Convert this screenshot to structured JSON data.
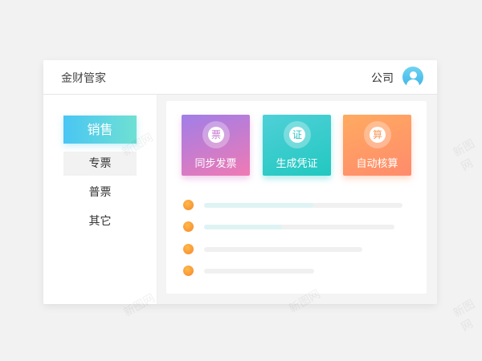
{
  "app": {
    "title": "金财管家"
  },
  "header": {
    "company_label": "公司",
    "avatar_icon": "user-avatar-icon"
  },
  "sidebar": {
    "primary_button": "销售",
    "items": [
      {
        "label": "专票",
        "selected": true
      },
      {
        "label": "普票",
        "selected": false
      },
      {
        "label": "其它",
        "selected": false
      }
    ]
  },
  "cards": [
    {
      "icon_char": "票",
      "label": "同步发票",
      "color_from": "#a07ee8",
      "color_to": "#f07ab4"
    },
    {
      "icon_char": "证",
      "label": "生成凭证",
      "color_from": "#4fd0d8",
      "color_to": "#22c8c0"
    },
    {
      "icon_char": "算",
      "label": "自动核算",
      "color_from": "#ffaa60",
      "color_to": "#ff8b6c"
    }
  ],
  "list_rows": [
    {
      "progress": 0.55
    },
    {
      "progress": 0.41
    },
    {
      "progress": 0.0
    },
    {
      "progress": 0.0
    }
  ],
  "watermark": "新图网"
}
